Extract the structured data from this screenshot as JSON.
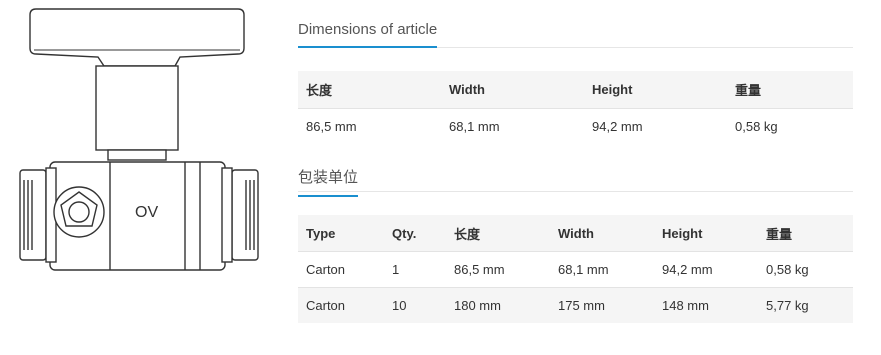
{
  "product": {
    "image_icon": "ball-valve-drawing",
    "logo_text": "OV"
  },
  "dimensions_section": {
    "title": "Dimensions of article",
    "headers": [
      "长度",
      "Width",
      "Height",
      "重量"
    ],
    "row": [
      "86,5 mm",
      "68,1 mm",
      "94,2 mm",
      "0,58 kg"
    ]
  },
  "packaging_section": {
    "title": "包装单位",
    "headers": [
      "Type",
      "Qty.",
      "长度",
      "Width",
      "Height",
      "重量"
    ],
    "rows": [
      [
        "Carton",
        "1",
        "86,5 mm",
        "68,1 mm",
        "94,2 mm",
        "0,58 kg"
      ],
      [
        "Carton",
        "10",
        "180 mm",
        "175 mm",
        "148 mm",
        "5,77 kg"
      ]
    ]
  },
  "colors": {
    "accent": "#1a8fcf",
    "header_bg": "#f5f5f5"
  }
}
